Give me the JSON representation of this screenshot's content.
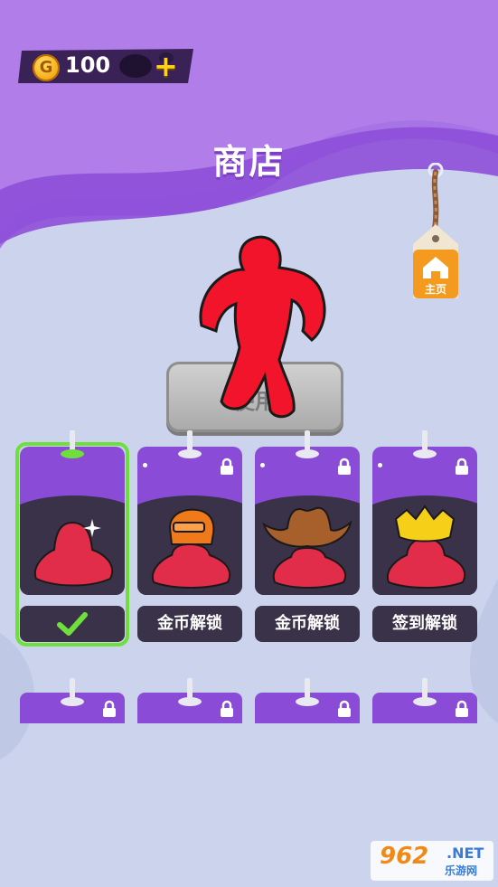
{
  "header": {
    "coins": "100",
    "plus": "+",
    "coin_symbol": "G",
    "title": "商店"
  },
  "home": {
    "label": "主页",
    "icon": "home-icon"
  },
  "pedestal": {
    "label": "使用"
  },
  "cards": [
    {
      "name": "red-witch-hat",
      "button": "",
      "selected": true,
      "locked": false
    },
    {
      "name": "orange-helmet",
      "button": "金币解锁",
      "selected": false,
      "locked": true
    },
    {
      "name": "cowboy-hat",
      "button": "金币解锁",
      "selected": false,
      "locked": true
    },
    {
      "name": "gold-crown",
      "button": "签到解锁",
      "selected": false,
      "locked": true
    }
  ],
  "watermark": {
    "number": "962",
    "net": ".NET",
    "sub": "乐游网"
  },
  "colors": {
    "purple": "#8a4cd6",
    "dark": "#3a3248",
    "select": "#6fe03b",
    "accent": "#ffd01a"
  }
}
